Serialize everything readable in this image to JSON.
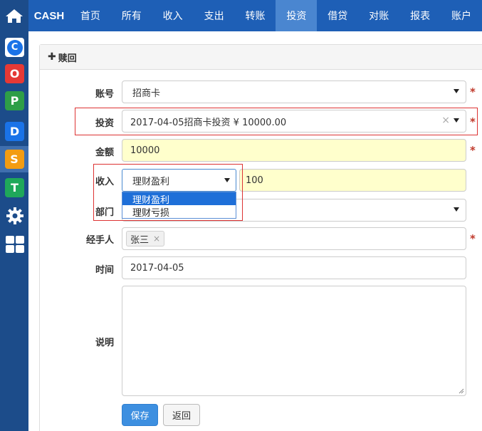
{
  "brand": "CASH",
  "nav": [
    "首页",
    "所有",
    "收入",
    "支出",
    "转账",
    "投资",
    "借贷",
    "对账",
    "报表",
    "账户"
  ],
  "nav_active_index": 5,
  "sidebar_icons": [
    {
      "letter": "",
      "name": "home-icon",
      "color": "#1c4c8a"
    },
    {
      "letter": "C",
      "name": "app-c-icon",
      "color": "#1a73e8"
    },
    {
      "letter": "O",
      "name": "app-o-icon",
      "color": "#e53935"
    },
    {
      "letter": "P",
      "name": "app-p-icon",
      "color": "#2e9e47"
    },
    {
      "letter": "D",
      "name": "app-d-icon",
      "color": "#1a73e8"
    },
    {
      "letter": "S",
      "name": "app-s-icon",
      "color": "#f39c12"
    },
    {
      "letter": "T",
      "name": "app-t-icon",
      "color": "#1fa85a"
    }
  ],
  "panel": {
    "title": "赎回"
  },
  "form": {
    "account": {
      "label": "账号",
      "value": "招商卡"
    },
    "investment": {
      "label": "投资",
      "value": "2017-04-05招商卡投资 ¥ 10000.00"
    },
    "amount": {
      "label": "金额",
      "value": "10000"
    },
    "income": {
      "label": "收入",
      "selected": "理财盈利",
      "value": "100",
      "options": [
        "理财盈利",
        "理财亏损"
      ]
    },
    "department": {
      "label": "部门",
      "value": ""
    },
    "handler": {
      "label": "经手人",
      "tags": [
        "张三"
      ]
    },
    "time": {
      "label": "时间",
      "value": "2017-04-05"
    },
    "description": {
      "label": "说明",
      "value": ""
    }
  },
  "required_mark": "*",
  "clear_mark": "×",
  "buttons": {
    "save": "保存",
    "back": "返回"
  }
}
